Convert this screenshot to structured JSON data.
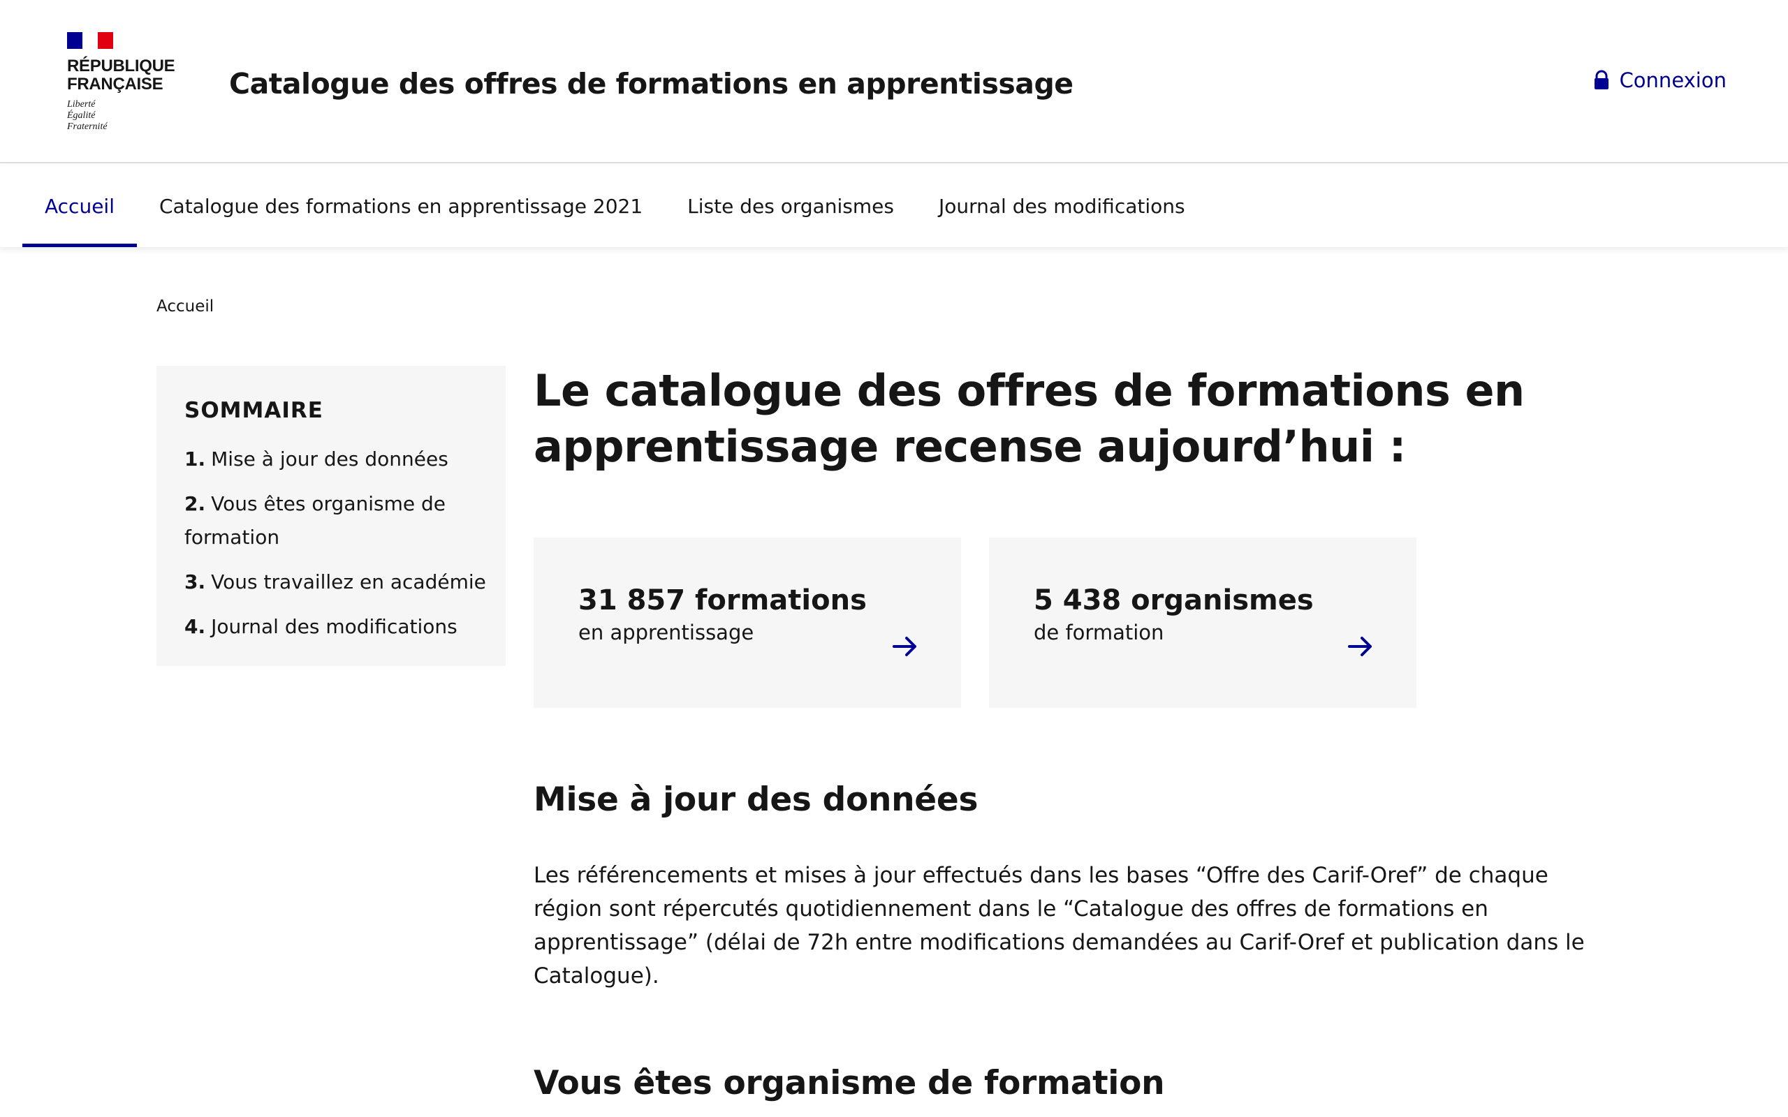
{
  "header": {
    "logo_line1": "RÉPUBLIQUE",
    "logo_line2": "FRANÇAISE",
    "motto_line1": "Liberté",
    "motto_line2": "Égalité",
    "motto_line3": "Fraternité",
    "site_title": "Catalogue des offres de formations en apprentissage",
    "login_label": "Connexion"
  },
  "nav": {
    "items": [
      {
        "label": "Accueil",
        "active": true
      },
      {
        "label": "Catalogue des formations en apprentissage 2021"
      },
      {
        "label": "Liste des organismes"
      },
      {
        "label": "Journal des modifications"
      }
    ]
  },
  "breadcrumb": {
    "current": "Accueil"
  },
  "sommaire": {
    "title": "SOMMAIRE",
    "items": [
      {
        "num": "1.",
        "label": "Mise à jour des données"
      },
      {
        "num": "2.",
        "label": "Vous êtes organisme de formation"
      },
      {
        "num": "3.",
        "label": "Vous travaillez en académie"
      },
      {
        "num": "4.",
        "label": "Journal des modifications"
      }
    ]
  },
  "main": {
    "hero_line1": "Le catalogue des offres de formations en",
    "hero_line2": "apprentissage recense aujourd’hui :",
    "cards": [
      {
        "value": "31 857 formations",
        "sub": "en apprentissage"
      },
      {
        "value": "5 438 organismes",
        "sub": "de formation"
      }
    ],
    "section1_title": "Mise à jour des données",
    "section1_text": "Les référencements et mises à jour effectués dans les bases “Offre des Carif-Oref” de chaque région sont répercutés quotidiennement dans le “Catalogue des offres de formations en apprentissage” (délai de 72h entre modifications demandées au Carif-Oref et publication dans le Catalogue).",
    "section2_title": "Vous êtes organisme de formation"
  },
  "colors": {
    "accent": "#000091",
    "flag_red": "#e1000f",
    "panel_bg": "#f6f6f6"
  },
  "icons": {
    "login": "lock-icon",
    "card": "arrow-right-icon"
  }
}
